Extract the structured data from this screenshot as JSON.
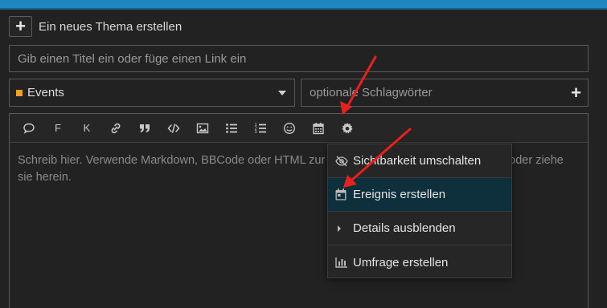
{
  "new_topic": {
    "label": "Ein neues Thema erstellen",
    "plus": "+"
  },
  "title_field": {
    "placeholder": "Gib einen Titel ein oder füge einen Link ein"
  },
  "category": {
    "label": "Events",
    "color": "#f1a21d"
  },
  "tags": {
    "placeholder": "optionale Schlagwörter",
    "plus": "+"
  },
  "toolbar": {
    "bold": "F",
    "italic": "K",
    "icons": [
      "speech-bubble-icon",
      "bold-icon",
      "italic-icon",
      "link-icon",
      "quote-icon",
      "code-icon",
      "image-icon",
      "bullet-list-icon",
      "numbered-list-icon",
      "emoji-icon",
      "calendar-icon",
      "gear-icon"
    ]
  },
  "editor": {
    "placeholder": "Schreib hier. Verwende Markdown, BBCode oder HTML zur Formatierung. Ziehe Bilder hierher oder ziehe sie herein."
  },
  "popup_menu": {
    "items": [
      {
        "label": "Sichtbarkeit umschalten",
        "icon": "eye-slash-icon"
      },
      {
        "label": "Ereignis erstellen",
        "icon": "calendar-day-icon",
        "active": true
      },
      {
        "label": "Details ausblenden",
        "icon": "caret-right-icon"
      },
      {
        "label": "Umfrage erstellen",
        "icon": "chart-bar-icon"
      }
    ]
  },
  "colors": {
    "accent": "#1f87c0",
    "background": "#222222",
    "annotation_arrow": "#e8201b",
    "active_item": "#0e2f3c"
  }
}
